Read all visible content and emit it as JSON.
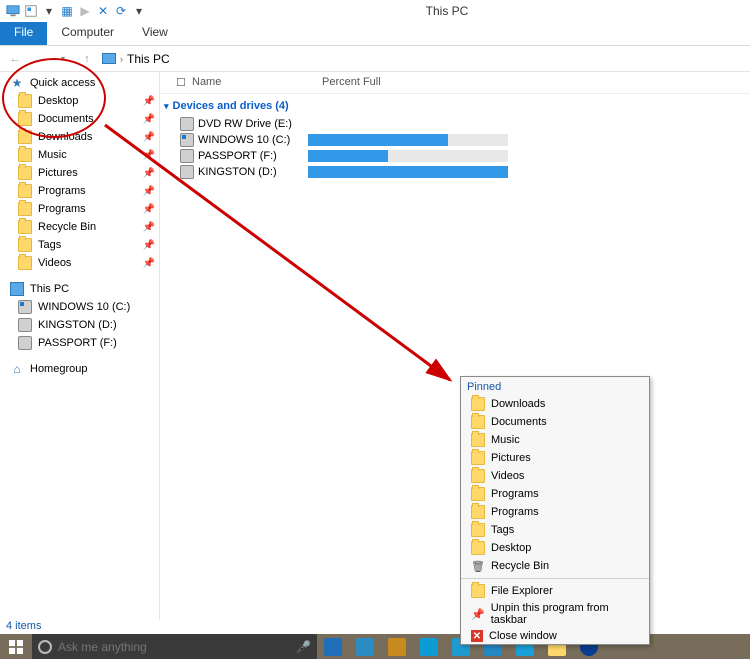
{
  "title": "This PC",
  "ribbon": {
    "file": "File",
    "computer": "Computer",
    "view": "View"
  },
  "breadcrumb": {
    "location": "This PC"
  },
  "columns": {
    "name": "Name",
    "percent": "Percent Full"
  },
  "group": {
    "header": "Devices and drives (4)"
  },
  "drives": [
    {
      "label": "DVD RW Drive (E:)",
      "fill": null
    },
    {
      "label": "WINDOWS 10 (C:)",
      "fill": 70
    },
    {
      "label": "PASSPORT (F:)",
      "fill": 40
    },
    {
      "label": "KINGSTON (D:)",
      "fill": 100
    }
  ],
  "nav": {
    "quick": "Quick access",
    "items": [
      "Desktop",
      "Documents",
      "Downloads",
      "Music",
      "Pictures",
      "Programs",
      "Programs",
      "Recycle Bin",
      "Tags",
      "Videos"
    ],
    "thispc": "This PC",
    "pcdrives": [
      "WINDOWS 10 (C:)",
      "KINGSTON (D:)",
      "PASSPORT (F:)"
    ],
    "homegroup": "Homegroup"
  },
  "jumplist": {
    "header": "Pinned",
    "pinned": [
      "Downloads",
      "Documents",
      "Music",
      "Pictures",
      "Videos",
      "Programs",
      "Programs",
      "Tags",
      "Desktop",
      "Recycle Bin"
    ],
    "fileexplorer": "File Explorer",
    "unpin": "Unpin this program from taskbar",
    "close": "Close window"
  },
  "status": "4 items",
  "search_placeholder": "Ask me anything",
  "taskbar_apps": [
    {
      "c": "#1e6fb7"
    },
    {
      "c": "#2b8cc4"
    },
    {
      "c": "#c68a1e"
    },
    {
      "c": "#0d9bd6"
    },
    {
      "c": "#1f9bd1"
    },
    {
      "c": "#2388c6"
    },
    {
      "c": "#1aa0d8"
    },
    {
      "c": "#ffd86b"
    },
    {
      "c": "#0b3d91"
    }
  ]
}
